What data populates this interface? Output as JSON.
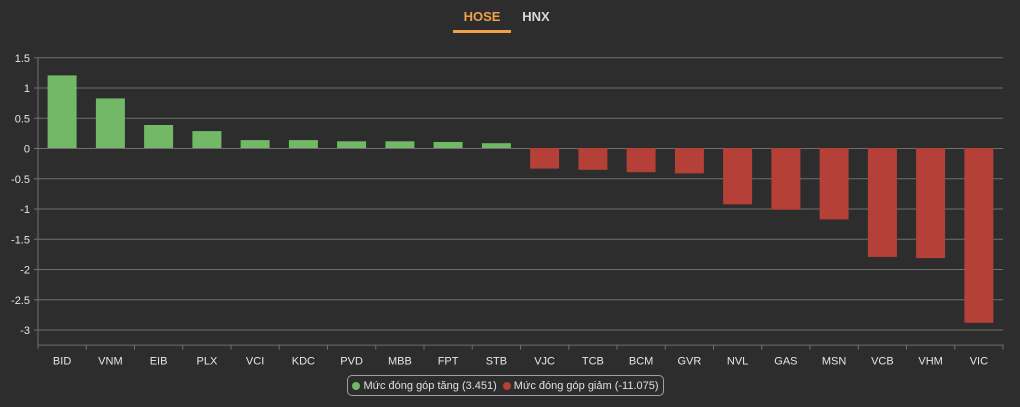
{
  "tabs": [
    {
      "label": "HOSE",
      "active": true
    },
    {
      "label": "HNX",
      "active": false
    }
  ],
  "colors": {
    "increase": "#72b866",
    "decrease": "#b54038",
    "active_tab": "#f0a04b",
    "grid": "#6e6e6e",
    "text": "#e6e6e6"
  },
  "legend": {
    "increase_label": "Mức đóng góp tăng (3.451)",
    "decrease_label": "Mức đóng góp giảm (-11.075)"
  },
  "chart_data": {
    "type": "bar",
    "categories": [
      "BID",
      "VNM",
      "EIB",
      "PLX",
      "VCI",
      "KDC",
      "PVD",
      "MBB",
      "FPT",
      "STB",
      "VJC",
      "TCB",
      "BCM",
      "GVR",
      "NVL",
      "GAS",
      "MSN",
      "VCB",
      "VHM",
      "VIC"
    ],
    "values": [
      1.2,
      0.82,
      0.38,
      0.28,
      0.13,
      0.13,
      0.11,
      0.11,
      0.1,
      0.08,
      -0.34,
      -0.36,
      -0.4,
      -0.42,
      -0.93,
      -1.02,
      -1.18,
      -1.8,
      -1.82,
      -2.89
    ],
    "yticks": [
      "1.5",
      "1",
      "0.5",
      "0",
      "-0.5",
      "-1",
      "-1.5",
      "-2",
      "-2.5",
      "-3"
    ],
    "ylim": [
      -3.25,
      1.5
    ],
    "grid": true,
    "legend_position": "bottom"
  }
}
